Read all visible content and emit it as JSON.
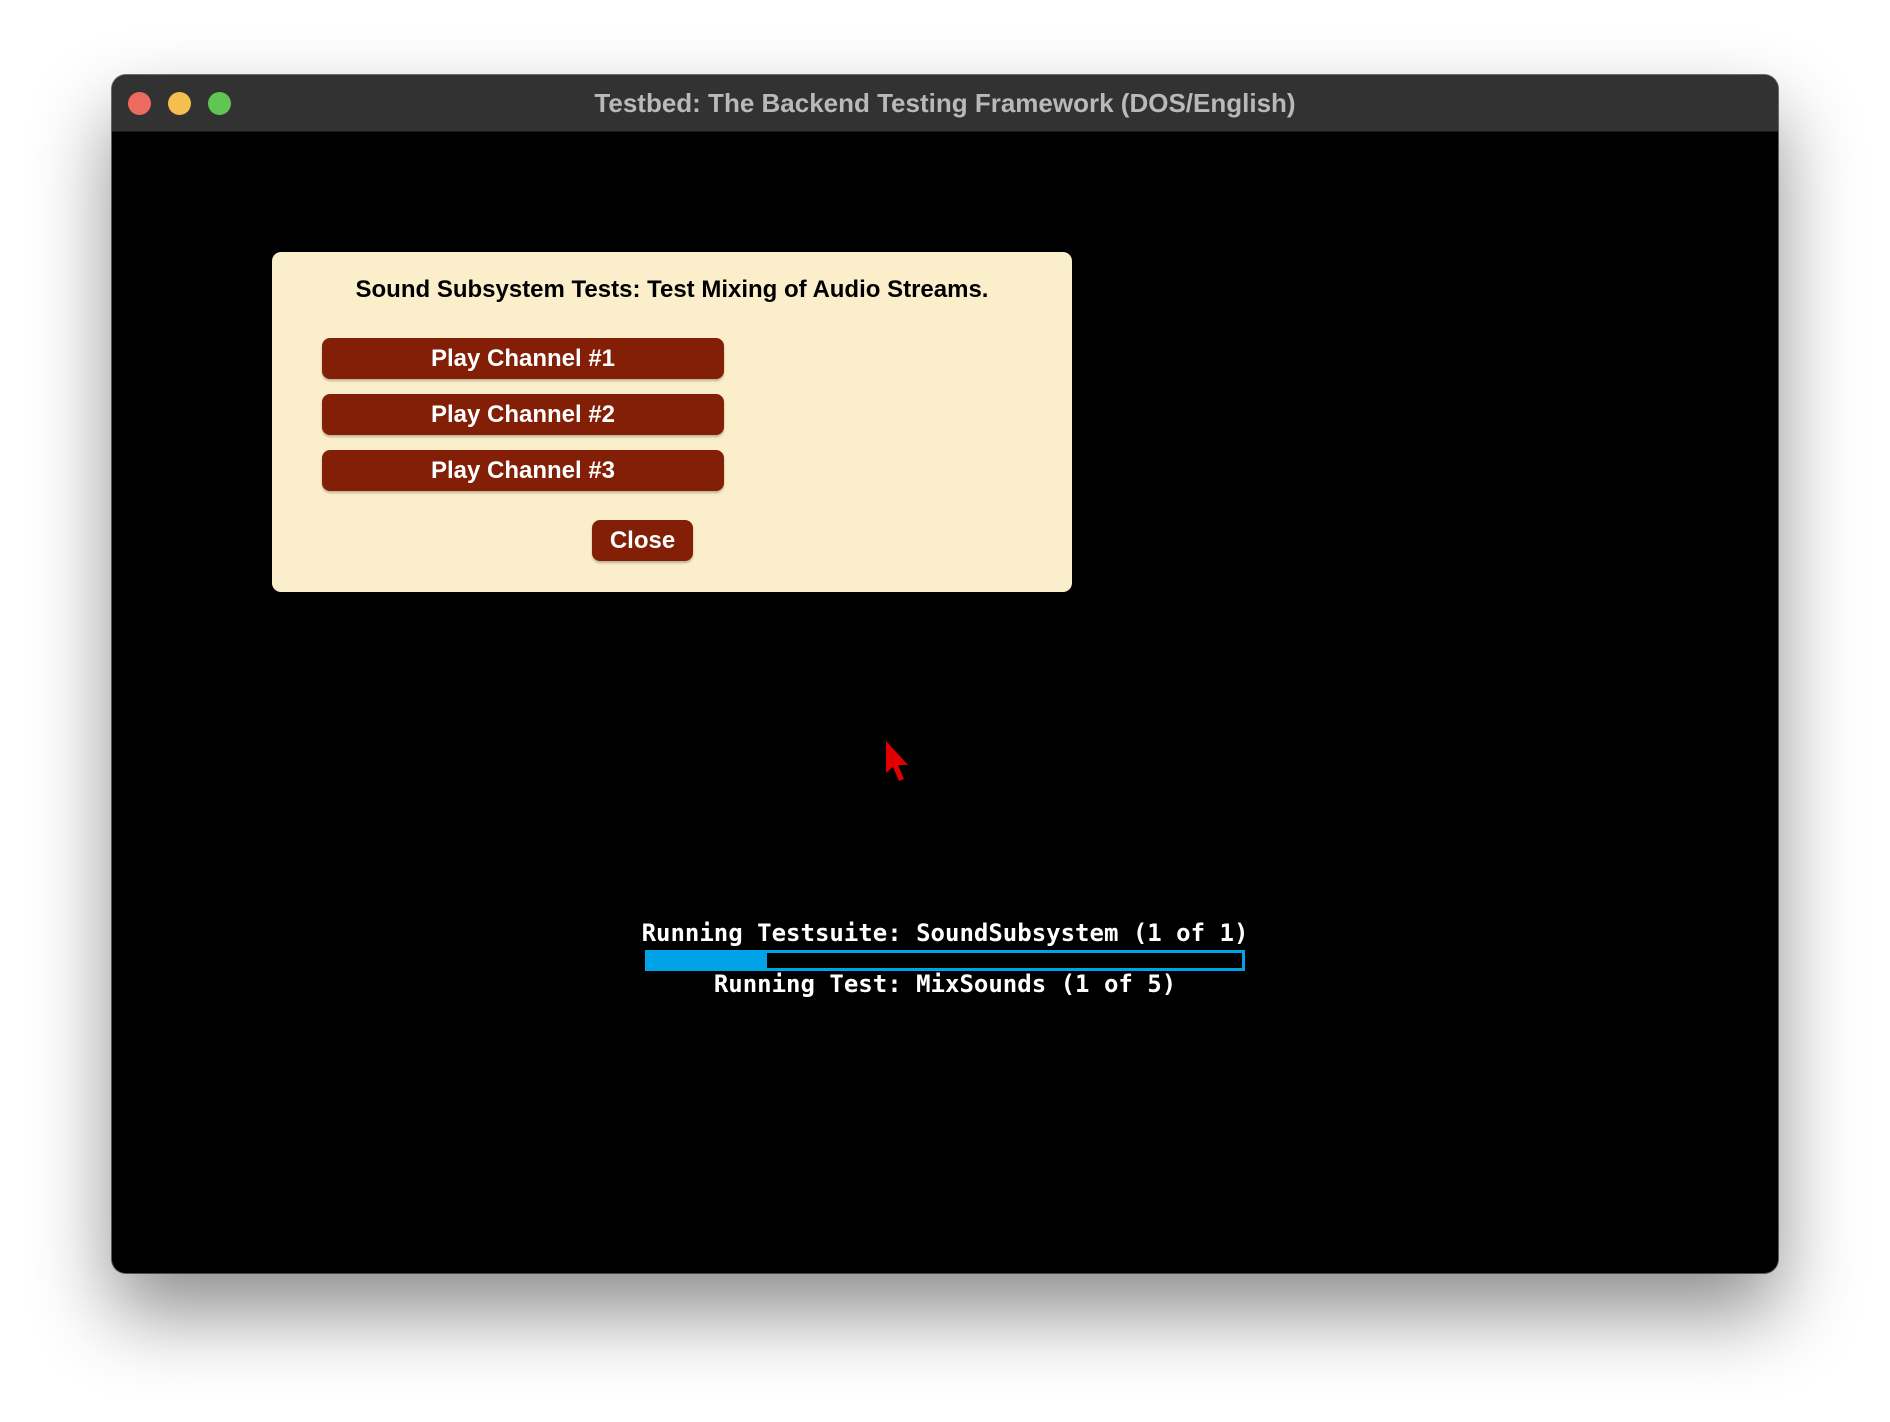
{
  "window": {
    "title": "Testbed: The Backend Testing Framework (DOS/English)"
  },
  "dialog": {
    "title": "Sound Subsystem Tests: Test Mixing of Audio Streams.",
    "buttons": [
      {
        "label": "Play Channel #1"
      },
      {
        "label": "Play Channel #2"
      },
      {
        "label": "Play Channel #3"
      }
    ],
    "close_label": "Close",
    "bg_color": "#fbeecb",
    "button_color": "#821f06"
  },
  "status": {
    "suite_line": "Running Testsuite: SoundSubsystem (1 of 1)",
    "test_line": "Running Test: MixSounds (1 of 5)",
    "progress_fraction": 0.2,
    "progress_color": "#00a2e8"
  },
  "icons": {
    "cursor": "mouse-pointer-icon",
    "close": "window-close-icon",
    "minimize": "window-minimize-icon",
    "maximize": "window-maximize-icon"
  }
}
